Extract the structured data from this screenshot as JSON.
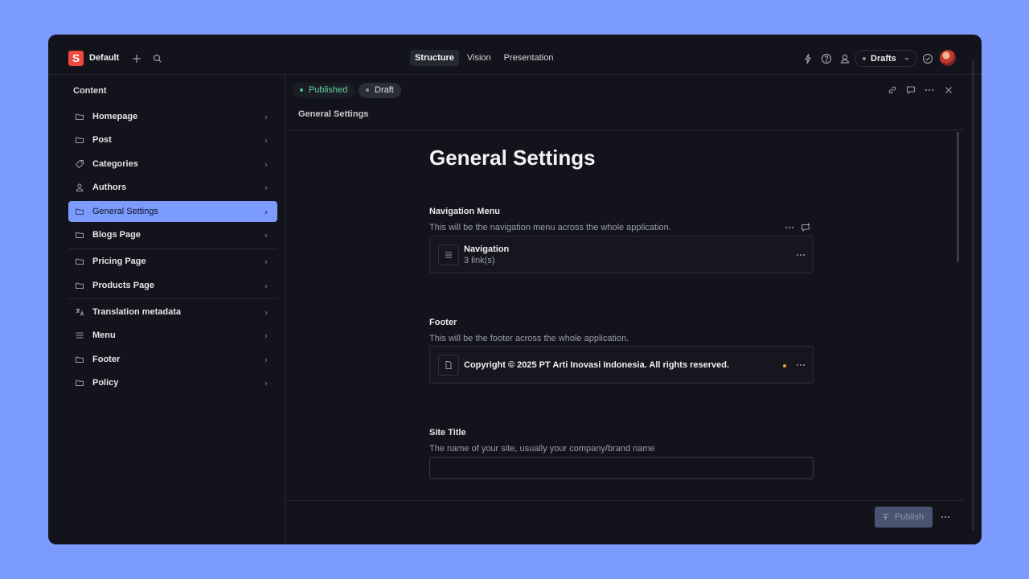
{
  "app": {
    "logo_letter": "S",
    "workspace": "Default"
  },
  "tabs": [
    {
      "label": "Structure",
      "active": true
    },
    {
      "label": "Vision",
      "active": false
    },
    {
      "label": "Presentation",
      "active": false
    }
  ],
  "perspective": {
    "label": "Drafts"
  },
  "sidebar": {
    "title": "Content",
    "items": [
      {
        "label": "Homepage",
        "icon": "folder-icon"
      },
      {
        "label": "Post",
        "icon": "folder-icon"
      },
      {
        "label": "Categories",
        "icon": "tag-icon"
      },
      {
        "label": "Authors",
        "icon": "person-icon"
      },
      {
        "label": "General Settings",
        "icon": "folder-icon",
        "active": true
      },
      {
        "label": "Blogs Page",
        "icon": "folder-icon"
      },
      {
        "label": "Pricing Page",
        "icon": "folder-icon"
      },
      {
        "label": "Products Page",
        "icon": "folder-icon"
      },
      {
        "label": "Translation metadata",
        "icon": "translate-icon"
      },
      {
        "label": "Menu",
        "icon": "menu-icon"
      },
      {
        "label": "Footer",
        "icon": "folder-icon"
      },
      {
        "label": "Policy",
        "icon": "folder-icon"
      }
    ]
  },
  "editor": {
    "status_published": "Published",
    "status_draft": "Draft",
    "doc_title": "General Settings",
    "heading": "General Settings",
    "fields": {
      "navigation": {
        "label": "Navigation Menu",
        "description": "This will be the navigation menu across the whole application.",
        "ref_title": "Navigation",
        "ref_subtitle": "3 link(s)"
      },
      "footer": {
        "label": "Footer",
        "description": "This will be the footer across the whole application.",
        "ref_title": "Copyright © 2025 PT Arti Inovasi Indonesia. All rights reserved."
      },
      "site_title": {
        "label": "Site Title",
        "description": "The name of your site, usually your company/brand name",
        "value": ""
      }
    },
    "publish_label": "Publish"
  },
  "colors": {
    "background": "#7b9bff",
    "window": "#13141b",
    "accent": "#7b9bff",
    "published": "#3fcb86",
    "logo": "#f0483e",
    "pending_dot": "#f0a23a"
  }
}
